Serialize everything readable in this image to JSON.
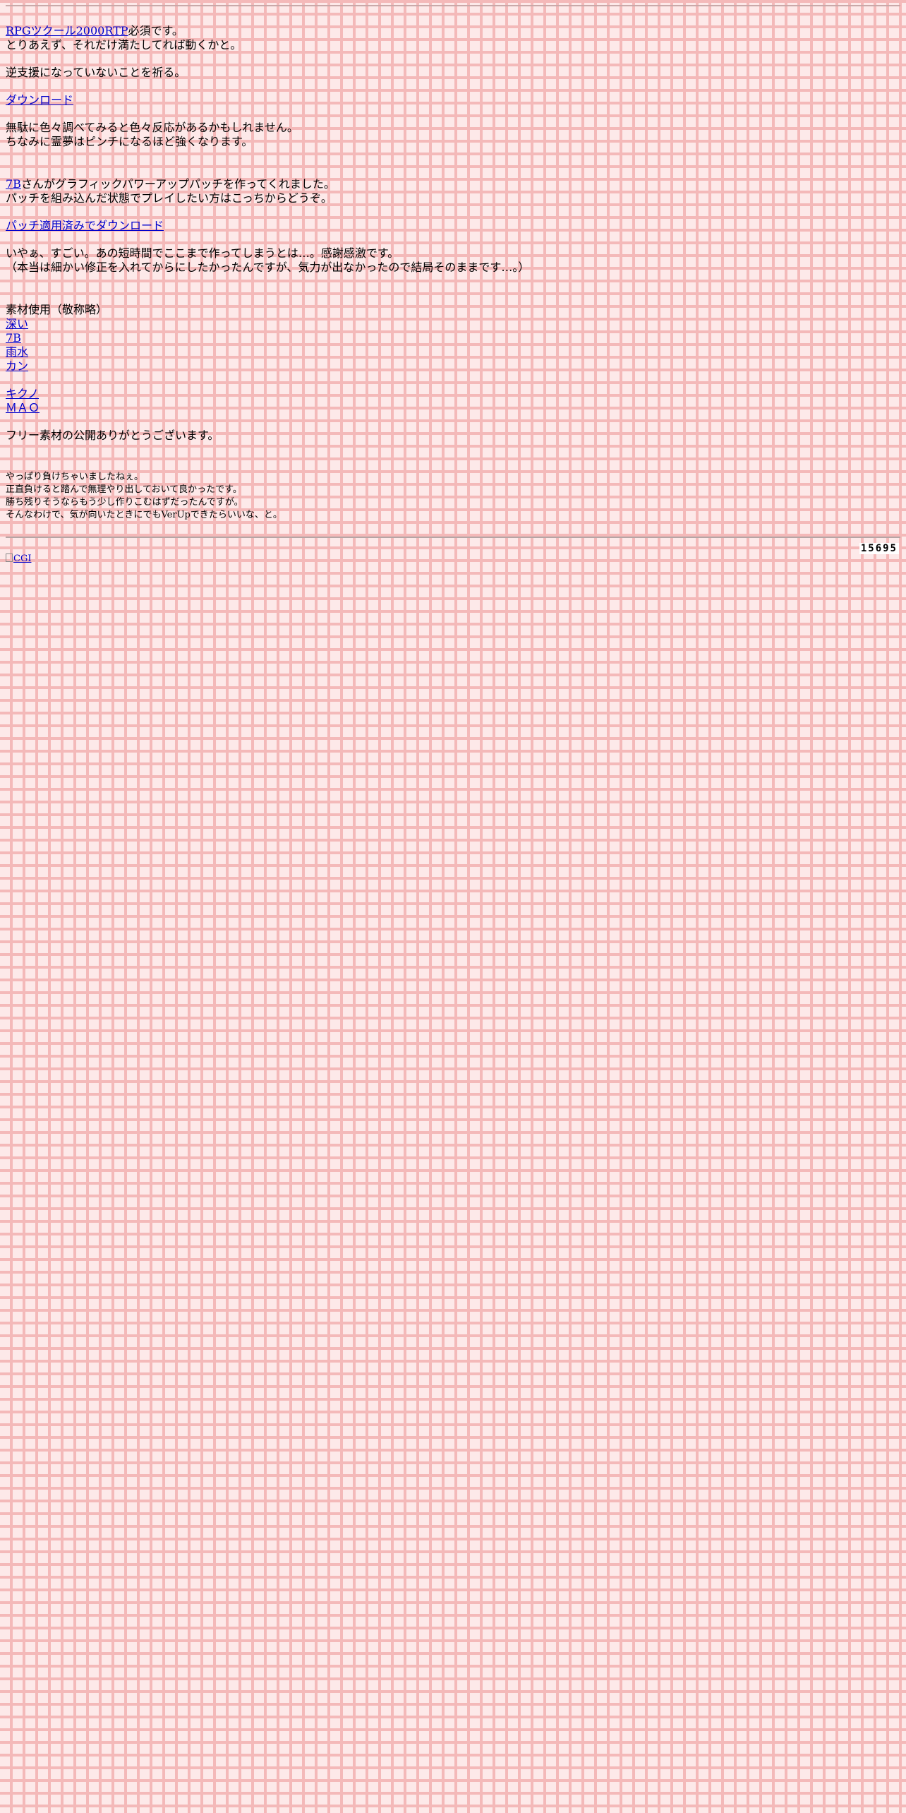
{
  "intro": {
    "rtp_link": "RPGツクール2000RTP",
    "rtp_suffix": "必須です。",
    "line2": "とりあえず、それだけ満たしてれば動くかと。"
  },
  "note_pray": "逆支援になっていないことを祈る。",
  "download_link": "ダウンロード",
  "hint": {
    "line1": "無駄に色々調べてみると色々反応があるかもしれません。",
    "line2": "ちなみに霊夢はピンチになるほど強くなります。"
  },
  "patch": {
    "author_link": "7B",
    "line1_suffix": "さんがグラフィックパワーアップパッチを作ってくれました。",
    "line2": "パッチを組み込んだ状態でプレイしたい方はこっちからどうぞ。",
    "download_link": "パッチ適用済みでダウンロード"
  },
  "thanks": {
    "line1": "いやぁ、すごい。あの短時間でここまで作ってしまうとは…。感謝感激です。",
    "line2": "（本当は細かい修正を入れてからにしたかったんですが、気力が出なかったので結局そのままです…。）"
  },
  "credits": {
    "heading": "素材使用（敬称略）",
    "group1": [
      "深い",
      "7B",
      "雨水",
      "カン"
    ],
    "group2": [
      "キクノ",
      "ＭＡＯ"
    ],
    "closing": "フリー素材の公開ありがとうございます。"
  },
  "afterword": {
    "line1": "やっぱり負けちゃいましたねぇ。",
    "line2": "正直負けると踏んで無理やり出しておいて良かったです。",
    "line3": "勝ち残りそうならもう少し作りこむはずだったんですが。",
    "line4": "そんなわけで、気が向いたときにでもVerUpできたらいいな、と。"
  },
  "footer": {
    "counter": "15695",
    "cgi_link": "CGI"
  }
}
